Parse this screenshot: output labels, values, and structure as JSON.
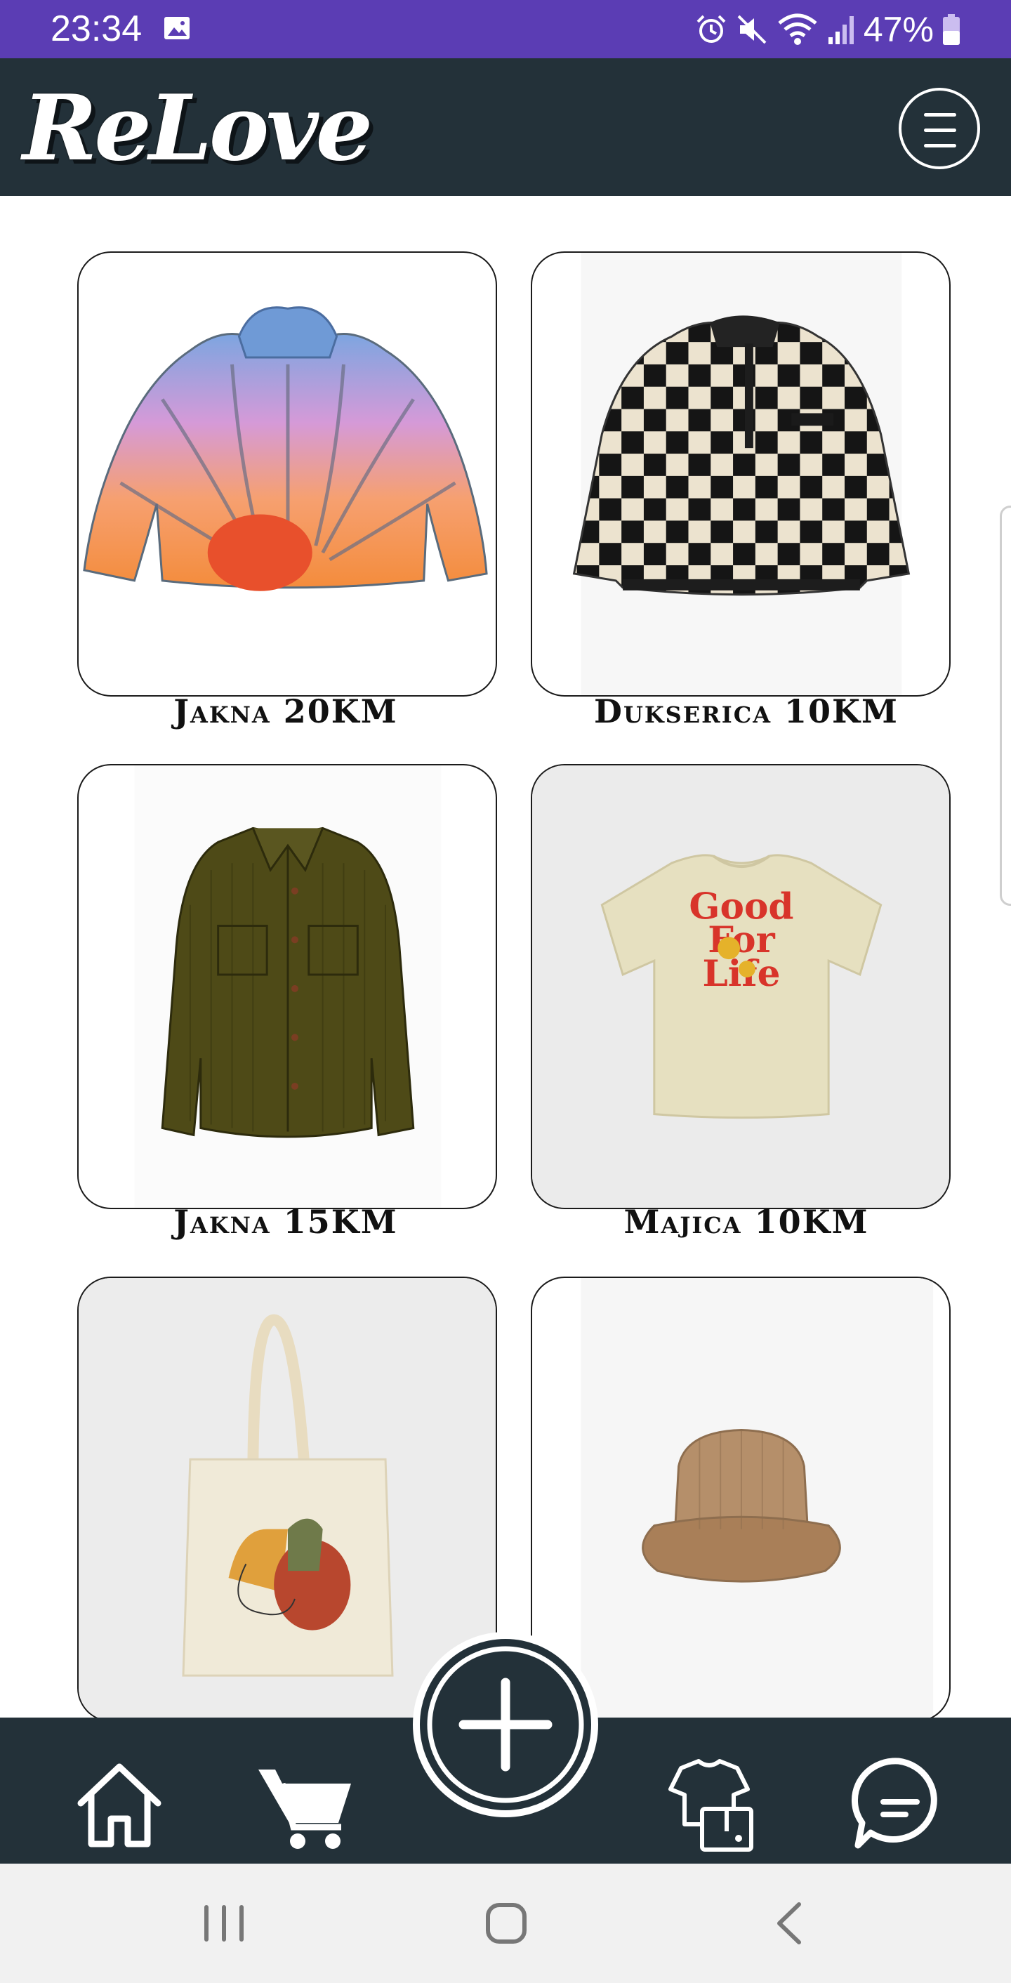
{
  "status_bar": {
    "time": "23:34",
    "battery_percent": "47%",
    "icons": [
      "gallery-icon",
      "alarm-icon",
      "mute-icon",
      "wifi-icon",
      "signal-icon",
      "battery-icon"
    ],
    "color": "#5b3db4"
  },
  "header": {
    "logo": "ReLove",
    "menu_icon": "hamburger-icon",
    "color": "#233139"
  },
  "products": [
    {
      "caption": "Jakna 20KM",
      "image": "puffer-jacket-image"
    },
    {
      "caption": "Dukserica 10KM",
      "image": "checkered-fleece-image"
    },
    {
      "caption": "Jakna 15KM",
      "image": "corduroy-jacket-image"
    },
    {
      "caption": "Majica 10KM",
      "image": "tshirt-image",
      "print": [
        "Good",
        "For",
        "Life"
      ]
    },
    {
      "caption": "",
      "image": "tote-bag-image"
    },
    {
      "caption": "",
      "image": "bucket-hat-image"
    }
  ],
  "bottom_nav": {
    "items": [
      "home-icon",
      "cart-icon",
      "add-icon",
      "wardrobe-icon",
      "chat-icon"
    ]
  },
  "system_nav": {
    "items": [
      "recent-apps-icon",
      "home-button-icon",
      "back-icon"
    ]
  }
}
